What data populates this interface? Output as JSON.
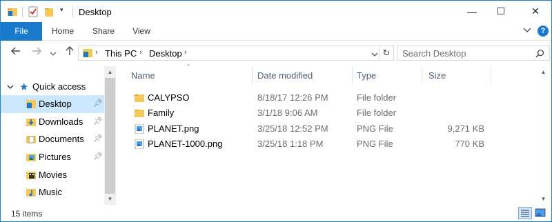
{
  "window": {
    "title": "Desktop",
    "accent": "#1979ca",
    "controls": {
      "minimize": "—",
      "maximize": "☐",
      "close": "✕"
    }
  },
  "quick_access_toolbar": {
    "icons": [
      "folder-icon",
      "properties-icon",
      "new-folder-icon",
      "customize-dropdown-icon"
    ]
  },
  "ribbon": {
    "tabs": [
      "File",
      "Home",
      "Share",
      "View"
    ]
  },
  "address_bar": {
    "segments": [
      "This PC",
      "Desktop"
    ],
    "search_placeholder": "Search Desktop"
  },
  "nav_pane": {
    "header": "Quick access",
    "items": [
      {
        "label": "Desktop",
        "icon": "desktop-folder-icon",
        "pinned": true,
        "selected": true
      },
      {
        "label": "Downloads",
        "icon": "downloads-folder-icon",
        "pinned": true,
        "selected": false
      },
      {
        "label": "Documents",
        "icon": "documents-folder-icon",
        "pinned": true,
        "selected": false
      },
      {
        "label": "Pictures",
        "icon": "pictures-folder-icon",
        "pinned": true,
        "selected": false
      },
      {
        "label": "Movies",
        "icon": "movies-folder-icon",
        "pinned": false,
        "selected": false
      },
      {
        "label": "Music",
        "icon": "music-folder-icon",
        "pinned": false,
        "selected": false
      }
    ]
  },
  "file_list": {
    "columns": [
      "Name",
      "Date modified",
      "Type",
      "Size"
    ],
    "rows": [
      {
        "name": "CALYPSO",
        "date": "8/18/17 12:26 PM",
        "type": "File folder",
        "size": "",
        "icon": "folder-icon"
      },
      {
        "name": "Family",
        "date": "3/1/18 9:06 AM",
        "type": "File folder",
        "size": "",
        "icon": "folder-icon"
      },
      {
        "name": "PLANET.png",
        "date": "3/25/18 12:52 PM",
        "type": "PNG File",
        "size": "9,271 KB",
        "icon": "image-file-icon"
      },
      {
        "name": "PLANET-1000.png",
        "date": "3/25/18 1:18 PM",
        "type": "PNG File",
        "size": "770 KB",
        "icon": "image-file-icon"
      }
    ]
  },
  "status_bar": {
    "item_count": "15 items"
  }
}
